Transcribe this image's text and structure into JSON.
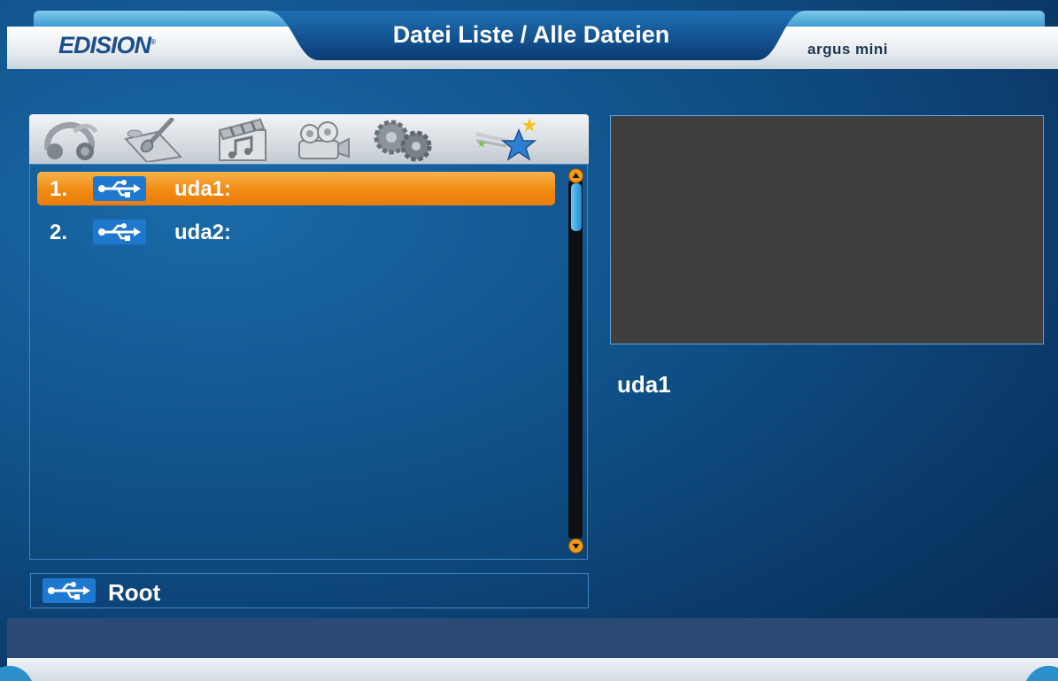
{
  "header": {
    "brand": "EDISION",
    "brand_mark": "®",
    "title": "Datei Liste / Alle Dateien",
    "model": "argus mini"
  },
  "categories": [
    {
      "icon": "music-headphones-icon"
    },
    {
      "icon": "paint-brush-icon"
    },
    {
      "icon": "video-clapper-icon"
    },
    {
      "icon": "camera-icon"
    },
    {
      "icon": "settings-gears-icon"
    },
    {
      "icon": "shooting-star-icon",
      "active": true
    }
  ],
  "files": [
    {
      "number": "1.",
      "icon": "usb-icon",
      "label": "uda1:",
      "selected": true
    },
    {
      "number": "2.",
      "icon": "usb-icon",
      "label": "uda2:",
      "selected": false
    }
  ],
  "scrollbar": {
    "position_fraction": 0
  },
  "footer_path": {
    "icon": "usb-icon",
    "label": "Root"
  },
  "preview": {
    "name": "uda1"
  },
  "colors": {
    "background": "#0f4f86",
    "selection": "#f08a12",
    "header_text": "#1c4f8c",
    "preview_bg": "#3f3f3f"
  }
}
